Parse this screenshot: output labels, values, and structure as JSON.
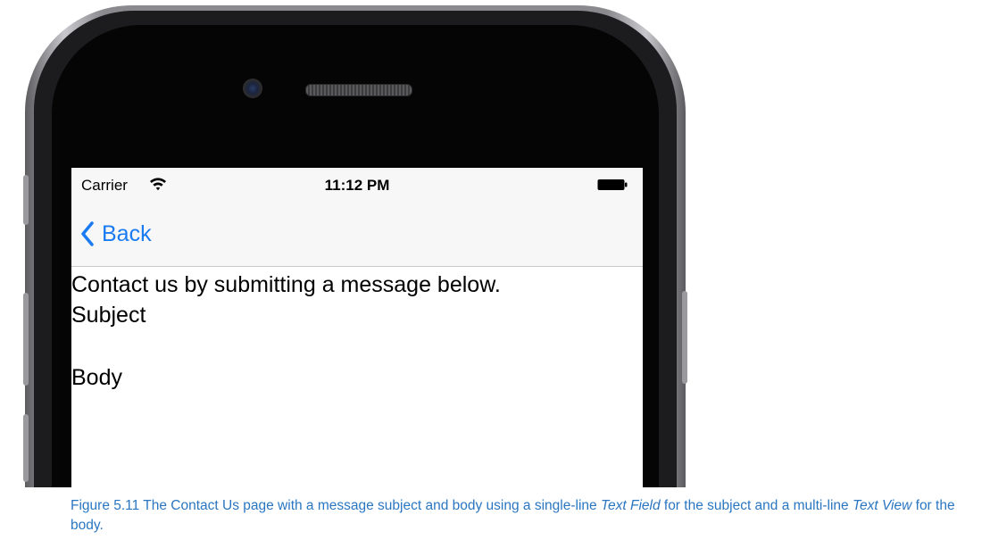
{
  "status_bar": {
    "carrier": "Carrier",
    "time": "11:12 PM"
  },
  "nav": {
    "back_label": "Back"
  },
  "content": {
    "intro": "Contact us by submitting a message below.",
    "subject_label": "Subject",
    "body_label": "Body"
  },
  "caption": {
    "part1": "Figure 5.11 The Contact Us page with a message subject and body using a single-line ",
    "em1": "Text Field",
    "part2": " for the subject and a multi-line ",
    "em2": "Text View",
    "part3": " for the body."
  },
  "colors": {
    "accent": "#1a7bf2",
    "caption": "#2a76c1",
    "bar_bg": "#f7f7f7"
  },
  "icons": {
    "back": "chevron-left-icon",
    "wifi": "wifi-icon",
    "battery": "battery-icon"
  }
}
